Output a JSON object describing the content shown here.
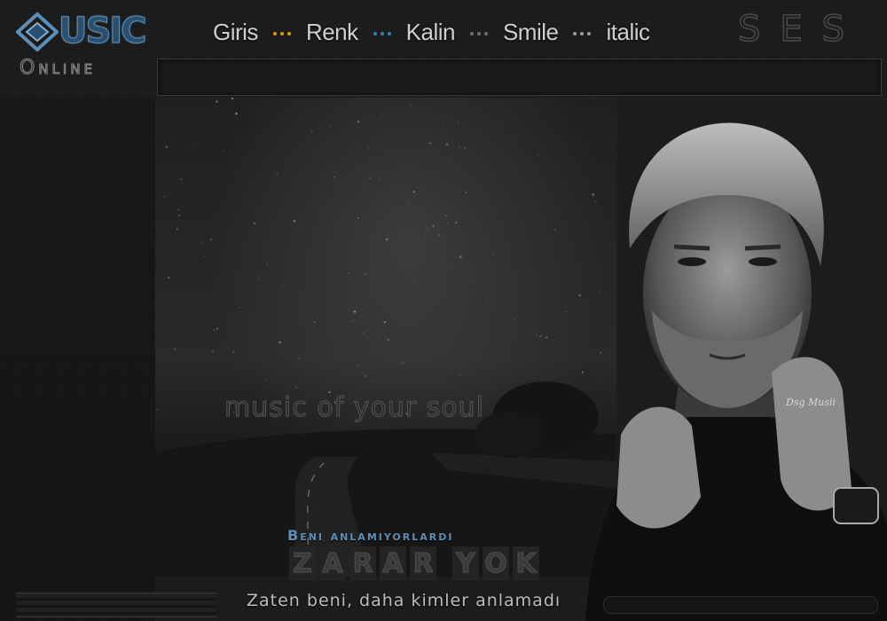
{
  "logo": {
    "brand": "USIC",
    "subtitle": "Online",
    "brand_color": "#5d8fb6"
  },
  "nav": [
    {
      "label": "Giris",
      "dot_color": "#d89b1f"
    },
    {
      "label": "Renk",
      "dot_color": "#2a86b7"
    },
    {
      "label": "Kalin",
      "dot_color": "#6f6f6f"
    },
    {
      "label": "Smile",
      "dot_color": "#9a9a9a"
    },
    {
      "label": "italic",
      "dot_color": null
    }
  ],
  "ses_label": "SES",
  "tagline": "music of your soul",
  "song": {
    "subtitle": "Beni anlamiyorlardi",
    "title_letters": [
      "Z",
      "A",
      "R",
      "A",
      "R",
      " ",
      "Y",
      "O",
      "K"
    ],
    "lyric": "Zaten beni, daha kimler anlamadı"
  },
  "signature": "Dsg Musii",
  "colors": {
    "accent_blue": "#5f8fb5",
    "background": "#1b1b1b"
  }
}
